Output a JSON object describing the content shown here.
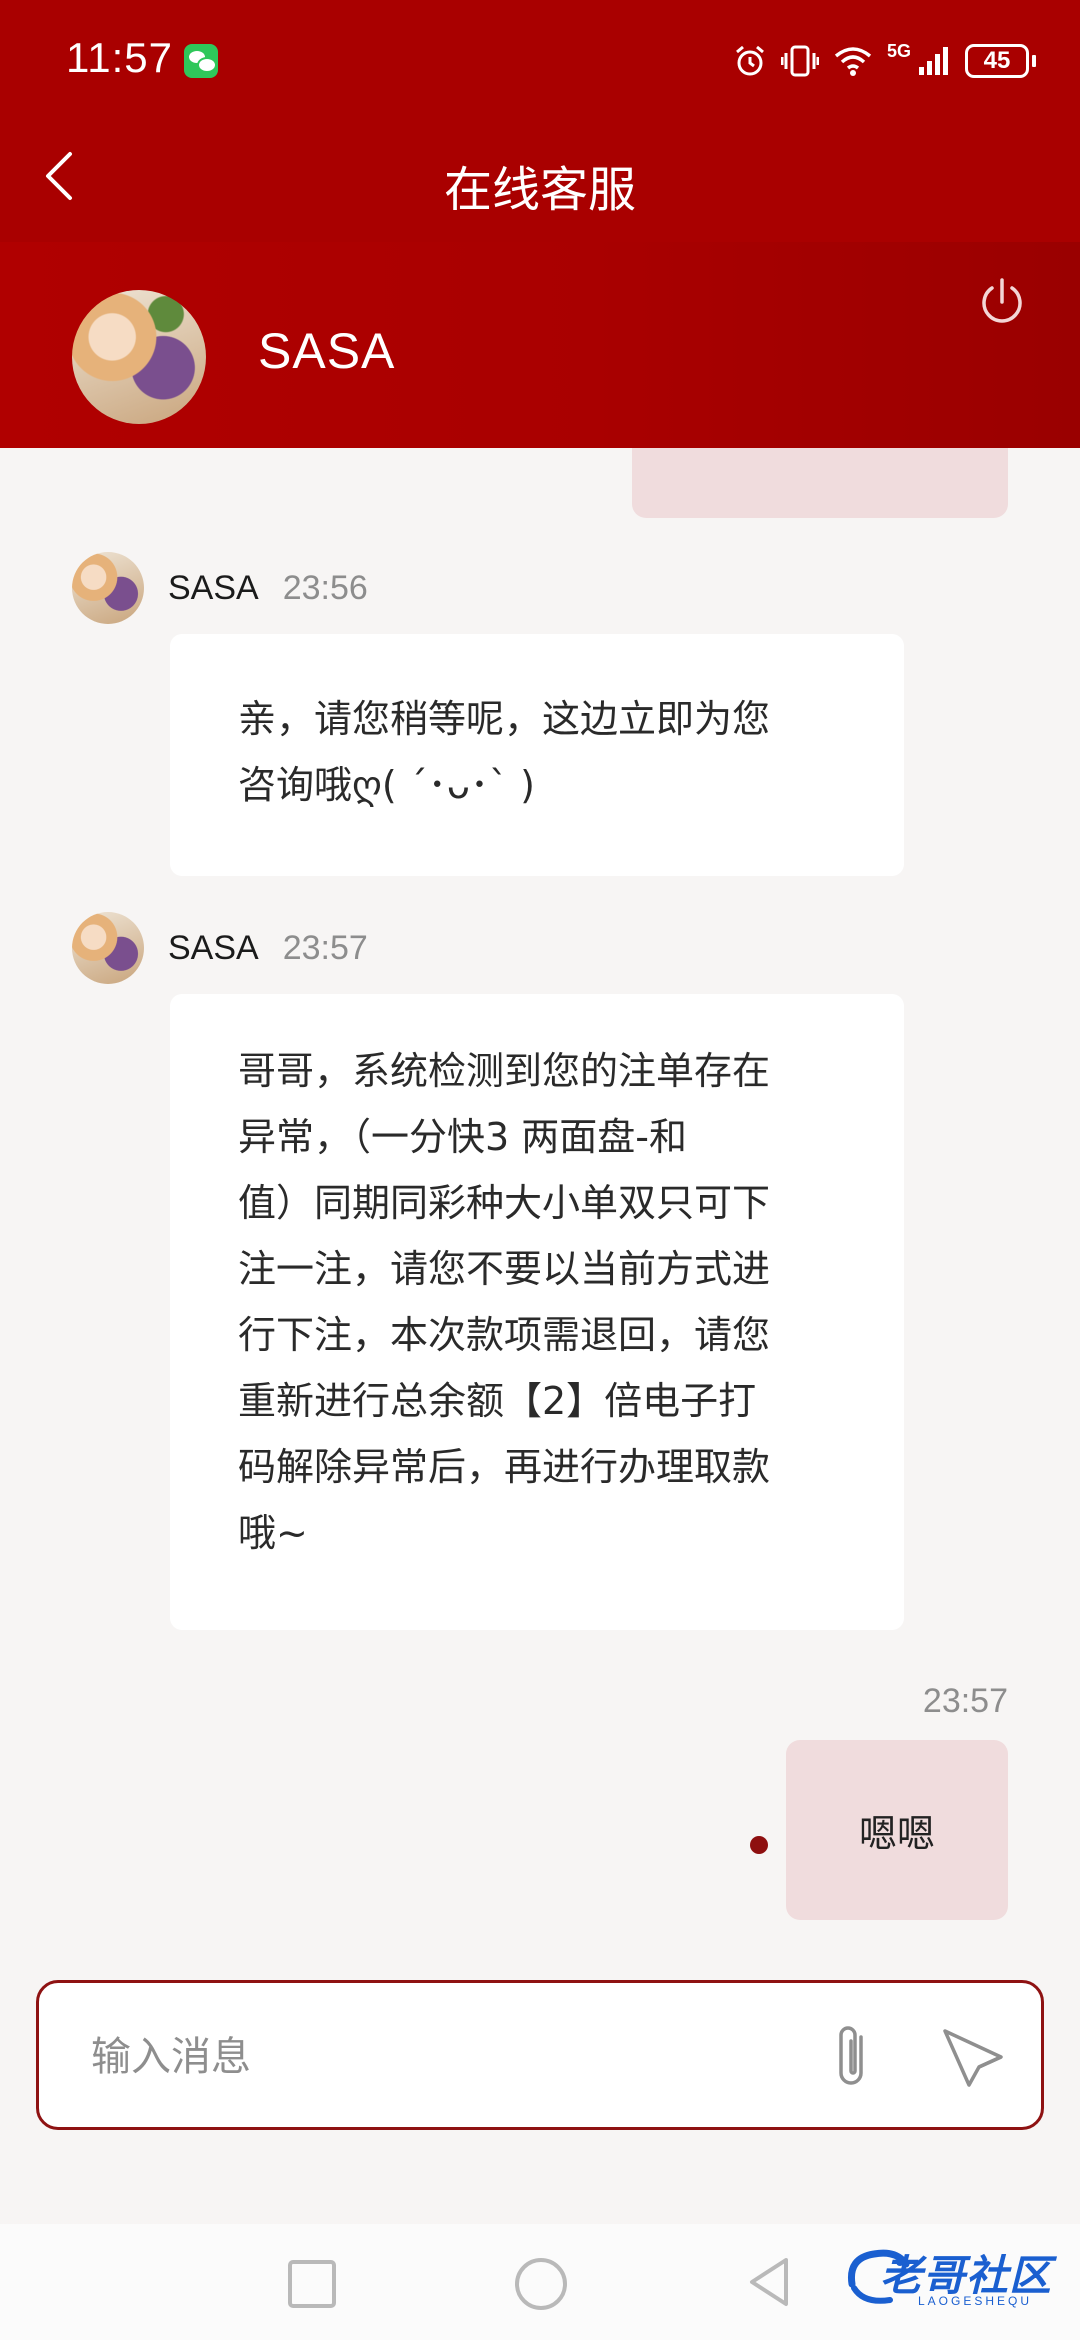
{
  "status_bar": {
    "time": "11:57",
    "network_label": "5G",
    "battery": "45",
    "icons": [
      "wechat-icon",
      "alarm-icon",
      "vibrate-icon",
      "wifi-icon",
      "signal-icon",
      "battery-icon"
    ]
  },
  "header": {
    "title": "在线客服",
    "back_icon": "chevron-left-icon"
  },
  "agent": {
    "name": "SASA",
    "power_icon": "power-icon"
  },
  "messages": [
    {
      "direction": "in",
      "sender": "SASA",
      "time": "23:56",
      "lines": [
        "亲，请您稍等呢，这边立即为您",
        "咨询哦ღ( ´･ᴗ･` )"
      ]
    },
    {
      "direction": "in",
      "sender": "SASA",
      "time": "23:57",
      "lines": [
        "哥哥，系统检测到您的注单存在",
        "异常，（一分快3 两面盘-和",
        "值）同期同彩种大小单双只可下",
        "注一注，请您不要以当前方式进",
        "行下注，本次款项需退回，请您",
        "重新进行总余额【2】倍电子打",
        "码解除异常后，再进行办理取款",
        "哦~"
      ]
    },
    {
      "direction": "out",
      "time": "23:57",
      "text": "嗯嗯"
    }
  ],
  "composer": {
    "placeholder": "输入消息",
    "attach_icon": "paperclip-icon",
    "send_icon": "send-icon"
  },
  "navbar": {
    "icons": [
      "recent-apps-icon",
      "home-icon",
      "back-icon"
    ]
  },
  "watermark": {
    "text": "老哥社区",
    "sub": "LAOGESHEQU"
  },
  "colors": {
    "brand_red": "#a90000",
    "outgoing_bubble": "#f0dcdd",
    "incoming_bubble": "#ffffff",
    "background": "#f7f5f4"
  }
}
